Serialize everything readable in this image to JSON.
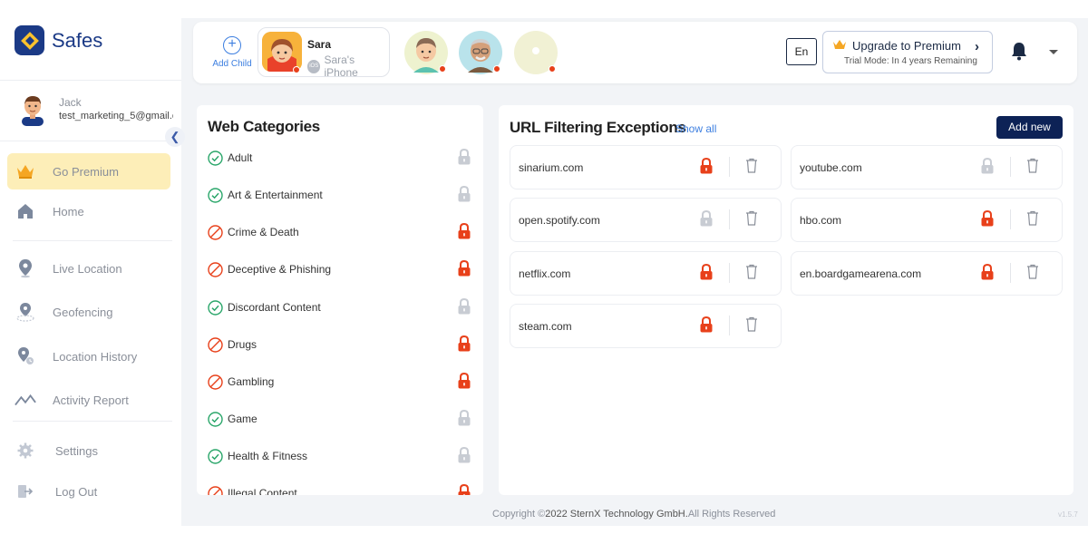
{
  "app": {
    "name": "Safes"
  },
  "profile": {
    "name": "Jack",
    "email": "test_marketing_5@gmail.c"
  },
  "sidebar": {
    "collapse_icon": "chevron-left-icon",
    "items": [
      {
        "label": "Go Premium",
        "icon": "crown-icon"
      },
      {
        "label": "Home",
        "icon": "home-icon"
      },
      {
        "label": "Live Location",
        "icon": "location-pin-icon"
      },
      {
        "label": "Geofencing",
        "icon": "geofence-icon"
      },
      {
        "label": "Location History",
        "icon": "location-history-icon"
      },
      {
        "label": "Activity Report",
        "icon": "activity-chart-icon"
      },
      {
        "label": "Settings",
        "icon": "gear-icon"
      },
      {
        "label": "Log Out",
        "icon": "logout-icon"
      }
    ]
  },
  "topbar": {
    "add_child_label": "Add Child",
    "selected_child": {
      "name": "Sara",
      "device": "Sara's iPhone",
      "os_badge": "iOS"
    },
    "language": "En",
    "upgrade": {
      "title": "Upgrade to Premium",
      "subtitle": "Trial Mode: In 4 years  Remaining"
    }
  },
  "web_categories": {
    "title": "Web Categories",
    "items": [
      {
        "name": "Adult",
        "status": "allowed",
        "locked": false
      },
      {
        "name": "Art & Entertainment",
        "status": "allowed",
        "locked": false
      },
      {
        "name": "Crime & Death",
        "status": "blocked",
        "locked": true
      },
      {
        "name": "Deceptive & Phishing",
        "status": "blocked",
        "locked": true
      },
      {
        "name": "Discordant Content",
        "status": "allowed",
        "locked": false
      },
      {
        "name": "Drugs",
        "status": "blocked",
        "locked": true
      },
      {
        "name": "Gambling",
        "status": "blocked",
        "locked": true
      },
      {
        "name": "Game",
        "status": "allowed",
        "locked": false
      },
      {
        "name": "Health & Fitness",
        "status": "allowed",
        "locked": false
      },
      {
        "name": "Illegal Content",
        "status": "blocked",
        "locked": true
      }
    ]
  },
  "url_filtering": {
    "title": "URL Filtering Exceptions",
    "show_all_label": "Show all",
    "add_new_label": "Add new",
    "items": [
      {
        "url": "sinarium.com",
        "locked": true
      },
      {
        "url": "youtube.com",
        "locked": false
      },
      {
        "url": "open.spotify.com",
        "locked": false
      },
      {
        "url": "hbo.com",
        "locked": true
      },
      {
        "url": "netflix.com",
        "locked": true
      },
      {
        "url": "en.boardgamearena.com",
        "locked": true
      },
      {
        "url": "steam.com",
        "locked": true
      }
    ]
  },
  "footer": {
    "prefix": "Copyright ©",
    "company": "2022 SternX Technology GmbH.",
    "suffix": "All Rights Reserved",
    "version": "v1.5.7"
  },
  "colors": {
    "brand": "#1b3a86",
    "accent": "#3d7fe0",
    "danger": "#e8401a",
    "allowed": "#2aa66a",
    "premium": "#fdeeb8"
  }
}
